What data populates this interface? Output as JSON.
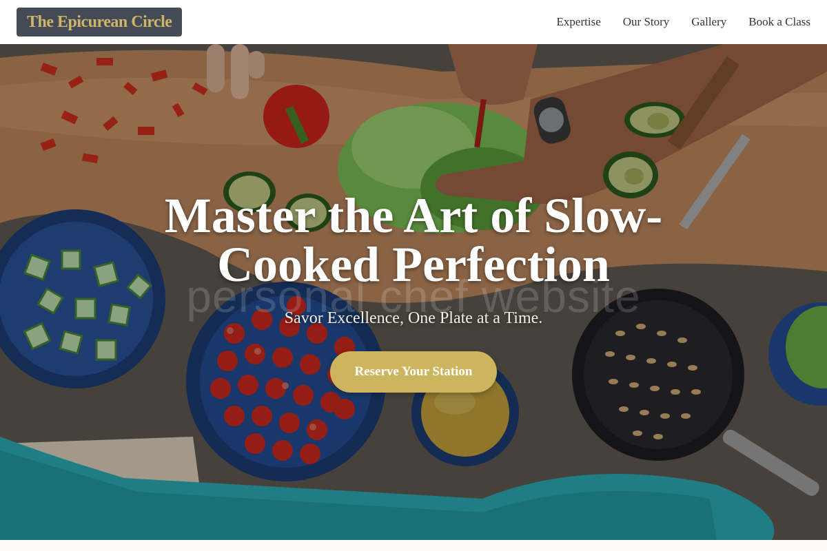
{
  "brand": {
    "name": "The Epicurean Circle"
  },
  "nav": {
    "items": [
      {
        "label": "Expertise"
      },
      {
        "label": "Our Story"
      },
      {
        "label": "Gallery"
      },
      {
        "label": "Book a Class"
      }
    ]
  },
  "hero": {
    "title": "Master the Art of Slow-Cooked Perfection",
    "watermark": "personal chef website",
    "subtitle": "Savor Excellence, One Plate at a Time.",
    "cta_label": "Reserve Your Station"
  },
  "colors": {
    "accent": "#cdb560",
    "logo_bg": "#454a57",
    "logo_text": "#cdb66a",
    "nav_text": "#2f3440"
  }
}
